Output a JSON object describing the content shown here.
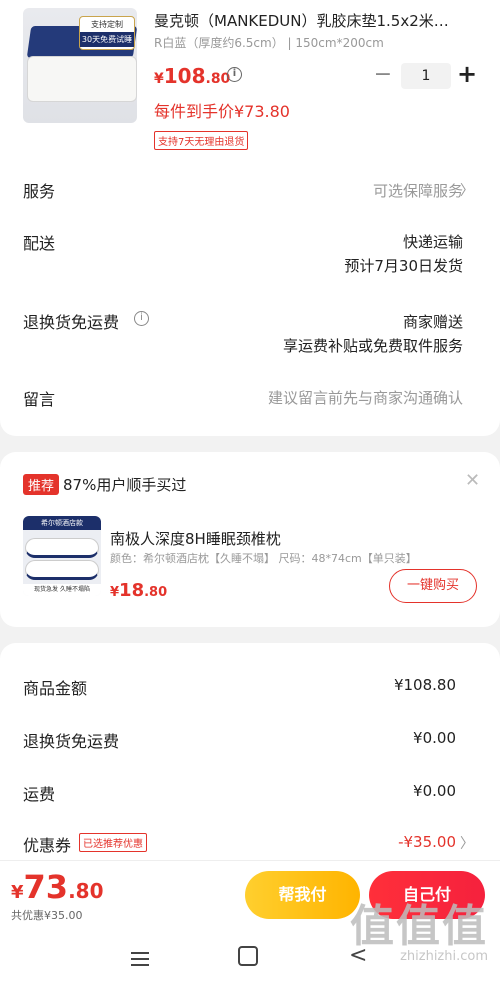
{
  "product": {
    "title": "曼克顿（MANKEDUN）乳胶床垫1.5x2米…",
    "spec": "R白蓝（厚度约6.5cm） | 150cm*200cm",
    "price_symbol": "¥",
    "price_int": "108",
    "price_dec": ".80",
    "quantity": "1",
    "final_price": "每件到手价¥73.80",
    "return_tag": "支持7天无理由退货",
    "image_badge_line1": "支持定制",
    "image_badge_line2": "30天免费试睡"
  },
  "rows": {
    "service_label": "服务",
    "service_value": "可选保障服务",
    "delivery_label": "配送",
    "delivery_value1": "快递运输",
    "delivery_value2": "预计7月30日发货",
    "return_label": "退换货免运费",
    "return_value1": "商家赠送",
    "return_value2": "享运费补贴或免费取件服务",
    "note_label": "留言",
    "note_placeholder": "建议留言前先与商家沟通确认"
  },
  "recommend": {
    "tag": "推荐",
    "text": "87%用户顺手买过",
    "title": "南极人深度8H睡眠颈椎枕",
    "spec": "颜色：希尔顿酒店枕【久睡不塌】  尺码：48*74cm【单只装】",
    "price_symbol": "¥",
    "price_int": "18",
    "price_dec": ".80",
    "buy_label": "一键购买",
    "img_top": "希尔顿酒店款",
    "img_bottom": "现货急发 久睡不塌陷"
  },
  "amounts": {
    "goods_label": "商品金额",
    "goods_value": "¥108.80",
    "return_label": "退换货免运费",
    "return_value": "¥0.00",
    "shipping_label": "运费",
    "shipping_value": "¥0.00",
    "coupon_label": "优惠券",
    "coupon_tag": "已选推荐优惠",
    "coupon_value": "-¥35.00"
  },
  "bottom": {
    "total_symbol": "¥",
    "total_int": "73",
    "total_dec": ".80",
    "saved": "共优惠¥35.00",
    "help_pay": "帮我付",
    "self_pay": "自己付"
  },
  "watermark": {
    "big": "值值值",
    "small": "zhizhizhi.com"
  },
  "colors": {
    "accent": "#e4332b",
    "help_button": "#ffb400",
    "self_button": "#f5213d"
  }
}
